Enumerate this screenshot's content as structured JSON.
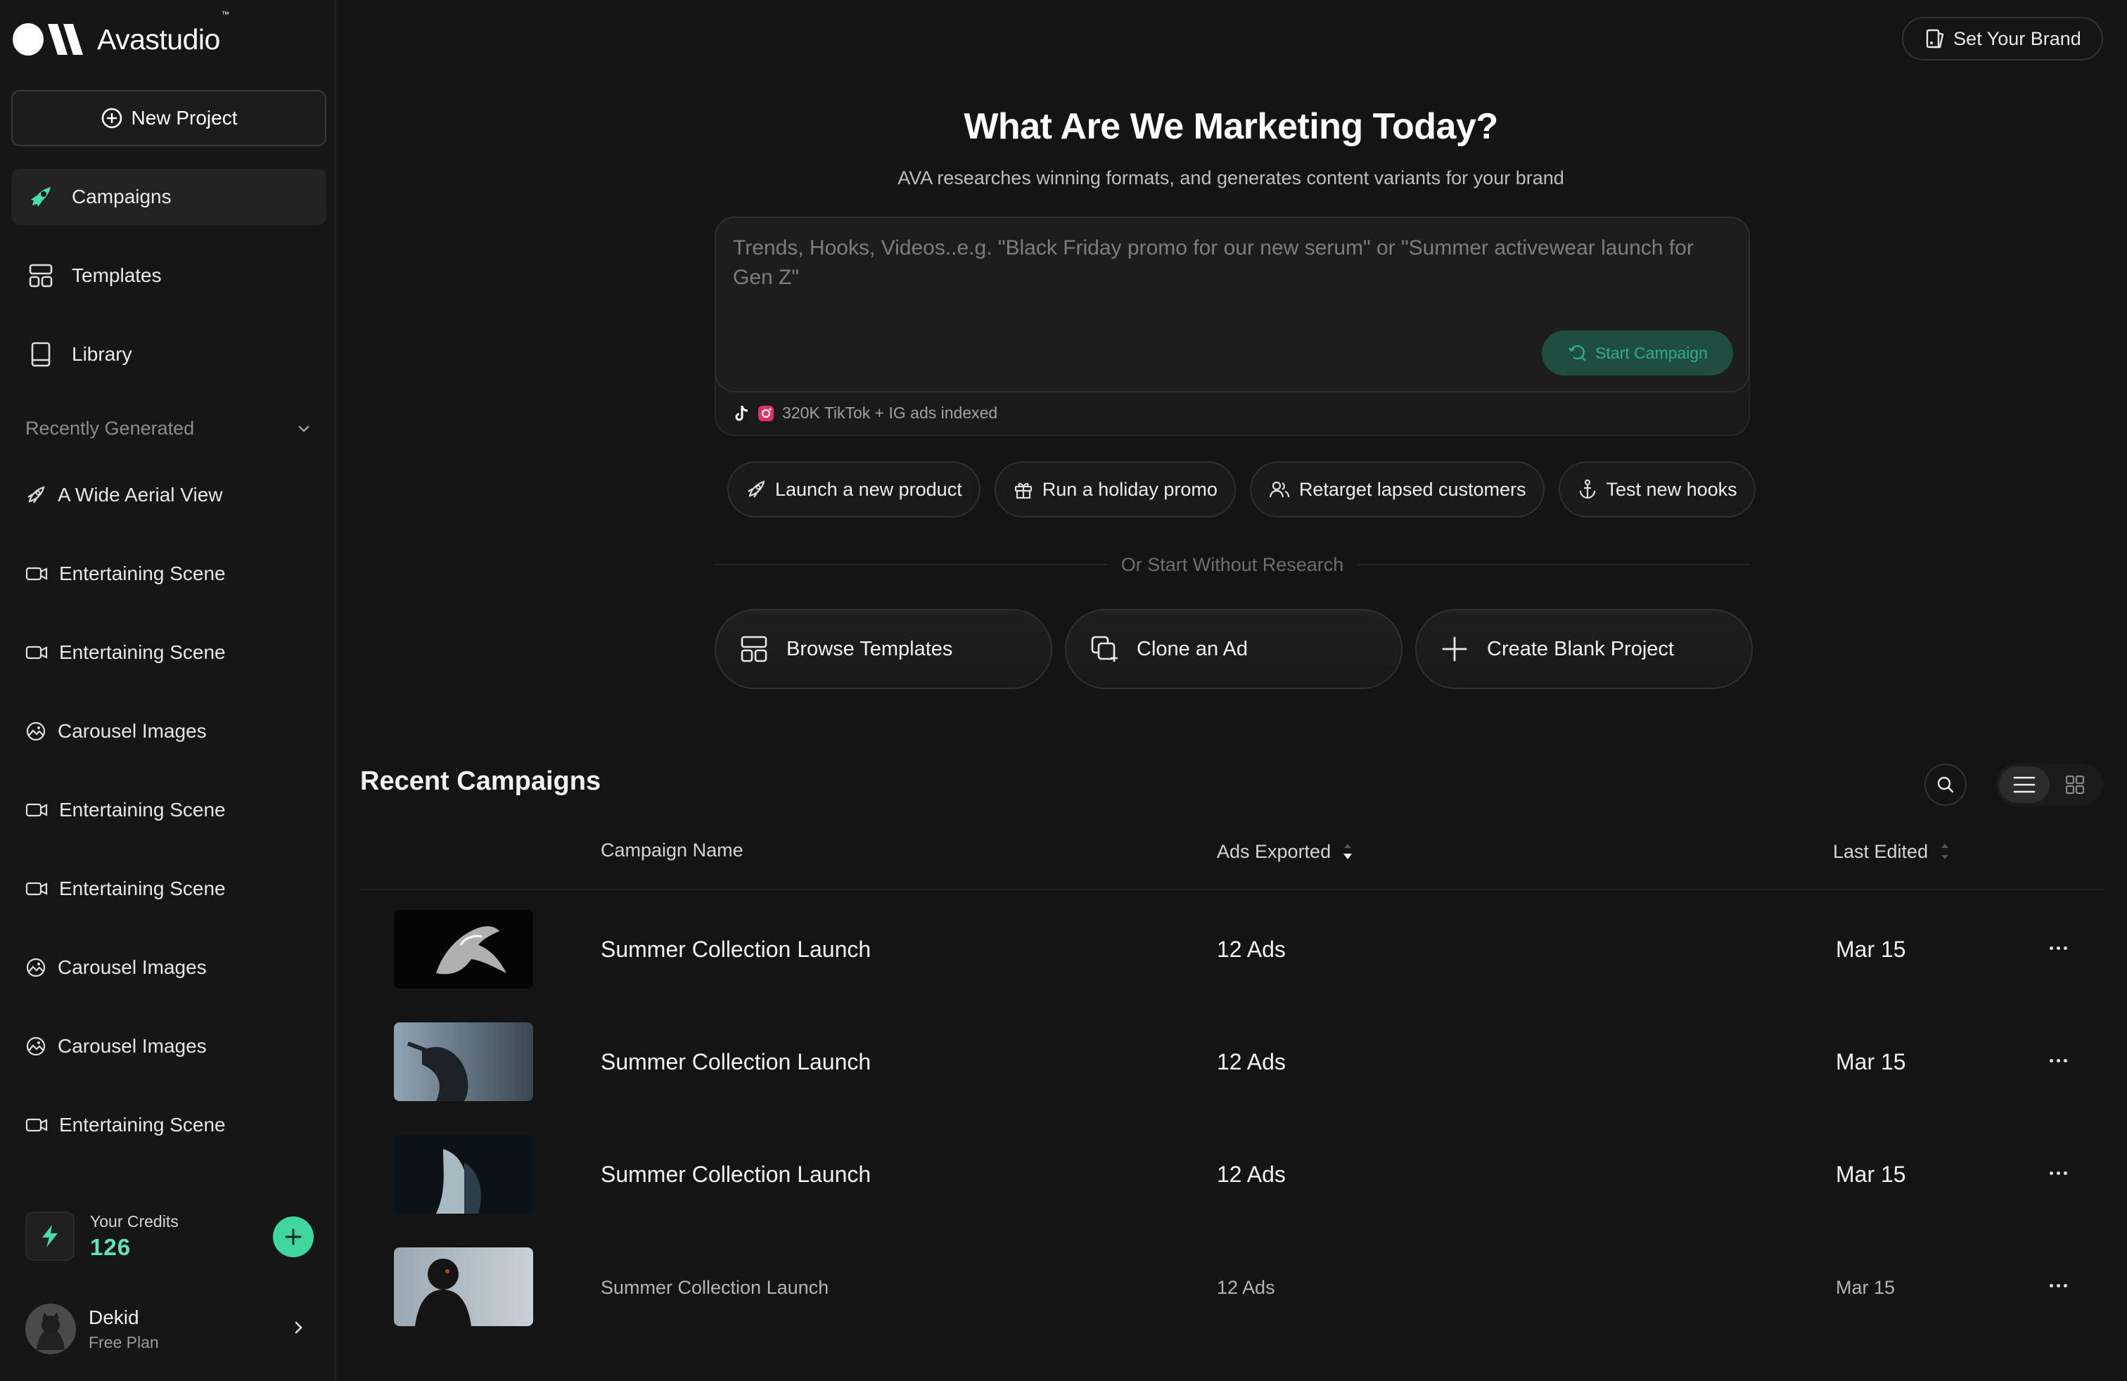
{
  "brand": {
    "name": "Avastudio",
    "tm": "™"
  },
  "sidebar": {
    "new_project": "New Project",
    "nav": [
      {
        "label": "Campaigns",
        "icon": "rocket-icon",
        "active": true
      },
      {
        "label": "Templates",
        "icon": "layout-icon",
        "active": false
      },
      {
        "label": "Library",
        "icon": "book-icon",
        "active": false
      }
    ],
    "recent_title": "Recently Generated",
    "recent": [
      {
        "label": "A Wide Aerial View",
        "icon": "rocket-icon"
      },
      {
        "label": "Entertaining Scene",
        "icon": "video-icon"
      },
      {
        "label": "Entertaining Scene",
        "icon": "video-icon"
      },
      {
        "label": "Carousel Images",
        "icon": "image-icon"
      },
      {
        "label": "Entertaining Scene",
        "icon": "video-icon"
      },
      {
        "label": "Entertaining Scene",
        "icon": "video-icon"
      },
      {
        "label": "Carousel Images",
        "icon": "image-icon"
      },
      {
        "label": "Carousel Images",
        "icon": "image-icon"
      },
      {
        "label": "Entertaining Scene",
        "icon": "video-icon"
      }
    ],
    "credits": {
      "label": "Your Credits",
      "value": "126"
    },
    "user": {
      "name": "Dekid",
      "plan": "Free Plan"
    }
  },
  "header": {
    "set_brand": "Set Your Brand"
  },
  "hero": {
    "title": "What Are We Marketing Today?",
    "subtitle": "AVA researches winning formats, and generates content variants for your brand",
    "placeholder": "Trends, Hooks, Videos..e.g. \"Black Friday promo for our new serum\" or \"Summer activewear launch for Gen Z\"",
    "start_button": "Start Campaign",
    "indexed": "320K TikTok + IG ads indexed"
  },
  "chips": [
    {
      "label": "Launch a new product",
      "icon": "rocket-icon"
    },
    {
      "label": "Run a holiday promo",
      "icon": "gift-icon"
    },
    {
      "label": "Retarget lapsed customers",
      "icon": "users-icon"
    },
    {
      "label": "Test new hooks",
      "icon": "anchor-icon"
    }
  ],
  "divider_text": "Or Start Without Research",
  "actions": [
    {
      "label": "Browse Templates",
      "icon": "layout-icon"
    },
    {
      "label": "Clone an Ad",
      "icon": "clone-icon"
    },
    {
      "label": "Create Blank Project",
      "icon": "plus-icon"
    }
  ],
  "recent_campaigns": {
    "title": "Recent Campaigns",
    "columns": {
      "name": "Campaign Name",
      "ads": "Ads Exported",
      "edited": "Last Edited"
    },
    "rows": [
      {
        "name": "Summer Collection Launch",
        "ads": "12 Ads",
        "edited": "Mar 15"
      },
      {
        "name": "Summer Collection Launch",
        "ads": "12 Ads",
        "edited": "Mar 15"
      },
      {
        "name": "Summer Collection Launch",
        "ads": "12 Ads",
        "edited": "Mar 15"
      },
      {
        "name": "Summer Collection Launch",
        "ads": "12 Ads",
        "edited": "Mar 15"
      }
    ]
  },
  "colors": {
    "accent": "#3fd6a0",
    "background": "#141414",
    "sidebar": "#161616"
  }
}
